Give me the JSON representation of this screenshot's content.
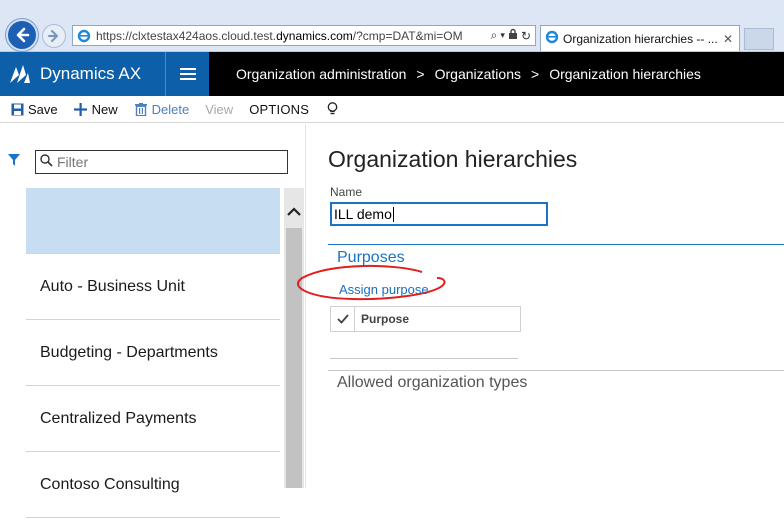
{
  "browser": {
    "url_prefix": "https://clxtestax424aos.cloud.test.",
    "url_domain": "dynamics.com",
    "url_suffix": "/?cmp=DAT&mi=OM",
    "tab_title": "Organization hierarchies -- ..."
  },
  "app": {
    "product_name": "Dynamics AX",
    "breadcrumb": [
      "Organization administration",
      "Organizations",
      "Organization hierarchies"
    ],
    "breadcrumb_sep": ">"
  },
  "actions": {
    "save": "Save",
    "new": "New",
    "delete": "Delete",
    "view": "View",
    "options": "OPTIONS"
  },
  "left_pane": {
    "filter_placeholder": "Filter",
    "items": [
      {
        "label": ""
      },
      {
        "label": "Auto - Business Unit"
      },
      {
        "label": "Budgeting - Departments"
      },
      {
        "label": "Centralized Payments"
      },
      {
        "label": "Contoso Consulting"
      }
    ]
  },
  "detail": {
    "title": "Organization hierarchies",
    "name_label": "Name",
    "name_value": "ILL demo",
    "purposes_tab": "Purposes",
    "assign_purpose": "Assign purpose",
    "grid_header_purpose": "Purpose",
    "allowed_types_tab": "Allowed organization types"
  },
  "colors": {
    "brand_blue": "#0e5fa9",
    "link_blue": "#1a6fc0",
    "selected_row": "#c6ddf2",
    "annotation_red": "#e02020"
  }
}
